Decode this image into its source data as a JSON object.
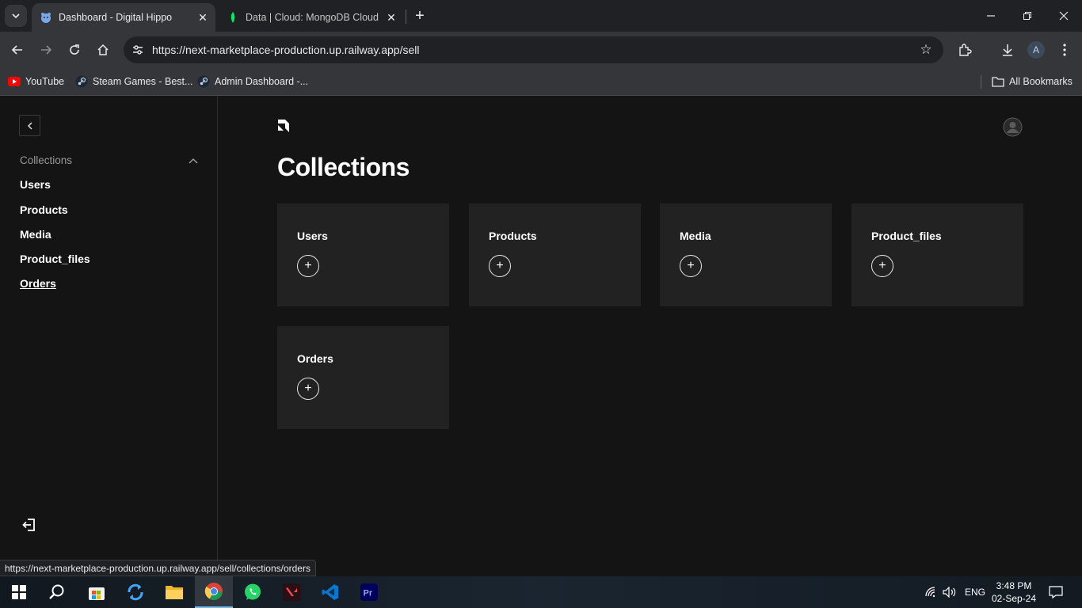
{
  "browser": {
    "tabs": [
      {
        "title": "Dashboard - Digital Hippo",
        "active": true
      },
      {
        "title": "Data | Cloud: MongoDB Cloud",
        "active": false
      }
    ],
    "url": "https://next-marketplace-production.up.railway.app/sell",
    "profile_initial": "A",
    "bookmarks": [
      {
        "label": "YouTube"
      },
      {
        "label": "Steam Games - Best..."
      },
      {
        "label": "Admin Dashboard -..."
      }
    ],
    "all_bookmarks_label": "All Bookmarks",
    "status_url": "https://next-marketplace-production.up.railway.app/sell/collections/orders"
  },
  "sidebar": {
    "group_label": "Collections",
    "items": [
      {
        "label": "Users"
      },
      {
        "label": "Products"
      },
      {
        "label": "Media"
      },
      {
        "label": "Product_files"
      },
      {
        "label": "Orders"
      }
    ]
  },
  "main": {
    "title": "Collections",
    "cards": [
      {
        "label": "Users"
      },
      {
        "label": "Products"
      },
      {
        "label": "Media"
      },
      {
        "label": "Product_files"
      },
      {
        "label": "Orders"
      }
    ],
    "add_glyph": "+"
  },
  "taskbar": {
    "language": "ENG",
    "time": "3:48 PM",
    "date": "02-Sep-24",
    "apps": [
      "start",
      "search",
      "store",
      "sync",
      "file-explorer",
      "chrome",
      "whatsapp",
      "valorant",
      "vscode",
      "premiere-pro"
    ]
  },
  "colors": {
    "background": "#141414",
    "card": "#222222",
    "chrome_tab": "#35363a",
    "chrome_frame": "#202124"
  }
}
